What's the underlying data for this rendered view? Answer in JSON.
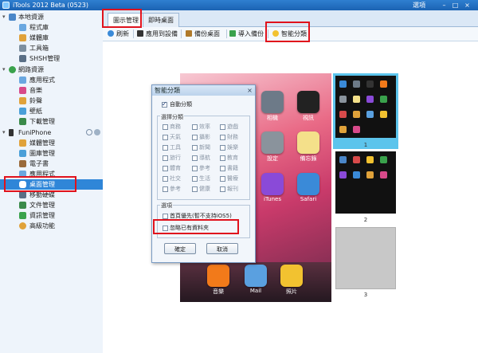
{
  "window": {
    "title": "iTools 2012 Beta (0523)",
    "menu_label": "選項"
  },
  "sidebar": {
    "groups": [
      {
        "label": "本地資源",
        "items": [
          "程式庫",
          "媒體庫",
          "工具箱",
          "SHSH管理"
        ]
      },
      {
        "label": "網路資源",
        "items": [
          "應用程式",
          "音樂",
          "鈴聲",
          "壁紙",
          "下載管理"
        ]
      },
      {
        "label": "FuniPhone",
        "items": [
          "媒體管理",
          "圖庫管理",
          "電子書",
          "應用程式",
          "桌面管理",
          "移動硬碟",
          "文件管理",
          "資訊管理",
          "高級功能"
        ]
      }
    ]
  },
  "tabs": [
    {
      "label": "圖示管理",
      "active": true
    },
    {
      "label": "即時桌面",
      "active": false
    }
  ],
  "toolbar": {
    "refresh": "刷新",
    "apply": "應用到設備",
    "backup": "備份桌面",
    "import": "導入備份",
    "smart": "智能分類"
  },
  "dialog": {
    "title": "智能分類",
    "auto_classify": "自動分類",
    "select_group_title": "選擇分類",
    "categories": [
      "商務",
      "效率",
      "遊戲",
      "天氣",
      "攝影",
      "財務",
      "工具",
      "新聞",
      "娛樂",
      "旅行",
      "導航",
      "教育",
      "體育",
      "參考",
      "書籍",
      "社交",
      "生活",
      "醫療",
      "參考",
      "健康",
      "報刊"
    ],
    "options_title": "選項",
    "option_first_page": "首頁優先(暫不支持iOS5)",
    "option_ignore_folders": "忽略已有資料夾",
    "ok": "確定",
    "cancel": "取消"
  },
  "phone": {
    "apps": [
      "相機",
      "視訊",
      "設定",
      "備忘錄",
      "iTunes",
      "Safari"
    ],
    "dock": [
      "音樂",
      "Mail",
      "照片"
    ]
  },
  "pages": [
    "1",
    "2",
    "3"
  ]
}
